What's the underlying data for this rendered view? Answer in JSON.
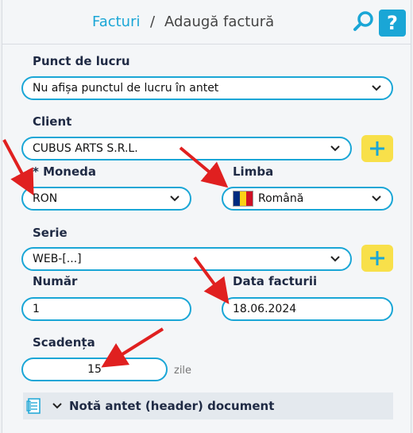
{
  "header": {
    "breadcrumb_link": "Facturi",
    "breadcrumb_sep": "/",
    "breadcrumb_current": "Adaugă factură",
    "help_label": "?"
  },
  "form": {
    "punct_label": "Punct de lucru",
    "punct_value": "Nu afișa punctul de lucru în antet",
    "client_label": "Client",
    "client_value": "CUBUS ARTS S.R.L.",
    "moneda_label": "* Moneda",
    "moneda_value": "RON",
    "limba_label": "Limba",
    "limba_value": "Română",
    "serie_label": "Serie",
    "serie_value": "WEB-[...]",
    "numar_label": "Număr",
    "numar_value": "1",
    "data_label": "Data facturii",
    "data_value": "18.06.2024",
    "scadenta_label": "Scadența",
    "scadenta_value": "15",
    "scadenta_unit": "zile"
  },
  "section": {
    "title": "Notă antet (header) document"
  },
  "colors": {
    "accent": "#1aa6d6",
    "add_button": "#f8e04a",
    "annotation_arrow": "#e02020"
  },
  "icons": {
    "search": "search-icon",
    "help": "help-icon",
    "add": "plus-icon",
    "chevron": "chevron-down-icon",
    "flag": "romania-flag-icon",
    "document": "document-icon"
  }
}
